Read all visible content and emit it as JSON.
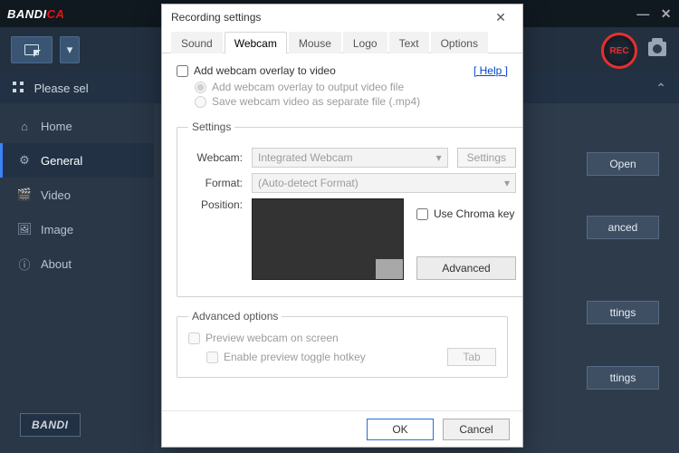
{
  "bg": {
    "brand": "BANDICAM",
    "rec_label": "REC",
    "select_bar": "Please sel",
    "sidebar": [
      {
        "label": "Home"
      },
      {
        "label": "General"
      },
      {
        "label": "Video"
      },
      {
        "label": "Image"
      },
      {
        "label": "About"
      }
    ],
    "right_buttons": [
      "Open",
      "anced",
      "ttings",
      "ttings"
    ],
    "bottom_logo": "BANDI"
  },
  "dialog": {
    "title": "Recording settings",
    "tabs": [
      "Sound",
      "Webcam",
      "Mouse",
      "Logo",
      "Text",
      "Options"
    ],
    "active_tab": "Webcam",
    "overlay_checkbox": "Add webcam overlay to video",
    "help": "Help",
    "radio1": "Add webcam overlay to output video file",
    "radio2": "Save webcam video as separate file (.mp4)",
    "settings_legend": "Settings",
    "labels": {
      "webcam": "Webcam:",
      "format": "Format:",
      "position": "Position:"
    },
    "webcam_value": "Integrated Webcam",
    "format_value": "(Auto-detect Format)",
    "settings_btn": "Settings",
    "chroma": "Use Chroma key",
    "advanced_btn": "Advanced",
    "adv_legend": "Advanced options",
    "adv_opt1": "Preview webcam on screen",
    "adv_opt2": "Enable preview toggle hotkey",
    "hotkey": "Tab",
    "ok": "OK",
    "cancel": "Cancel"
  }
}
